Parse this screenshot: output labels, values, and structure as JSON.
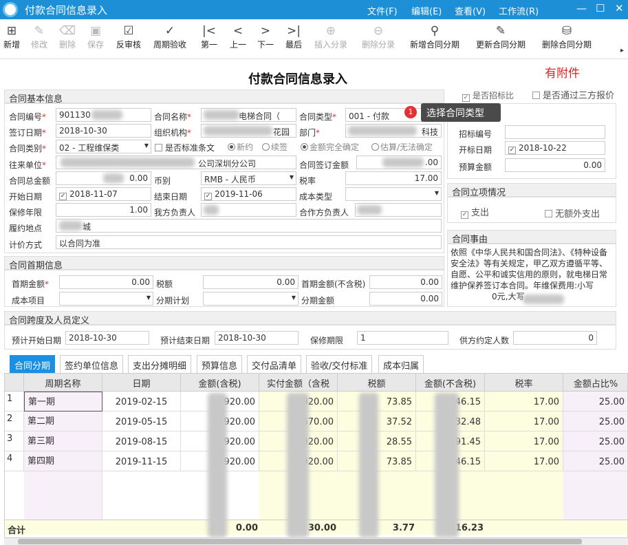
{
  "window": {
    "title": "付款合同信息录入",
    "menu": [
      "文件(F)",
      "编辑(E)",
      "查看(V)",
      "工作流(R)"
    ],
    "win": [
      "—",
      "☐",
      "✕"
    ]
  },
  "toolbar": [
    "新增",
    "修改",
    "删除",
    "保存",
    "反审核",
    "周期验收",
    "第一",
    "上一",
    "下一",
    "最后",
    "插入分录",
    "删除分录",
    "新增合同分期",
    "更新合同分期",
    "删除合同分期"
  ],
  "page": {
    "heading": "付款合同信息录入",
    "attachment": "有附件"
  },
  "basic": {
    "section": "合同基本信息",
    "contract_no_label": "合同编号",
    "contract_no": "901130",
    "contract_name_label": "合同名称",
    "contract_name": "电梯合同（",
    "contract_type_label": "合同类型",
    "contract_type": "001 - 付款",
    "sign_date_label": "签订日期",
    "sign_date": "2018-10-30",
    "org_label": "组织机构",
    "org": "花园",
    "dept_label": "部门",
    "dept": "科技",
    "category_label": "合同类别",
    "category": "02 - 工程维保类",
    "std_clause": "是否标准条文",
    "radio_new": "新约",
    "radio_renew": "续签",
    "radio_fixed": "金额完全确定",
    "radio_est": "估算/无法确定",
    "partner_label": "往来单位",
    "partner": "公司深圳分公司",
    "sign_amount_label": "合同签订金额",
    "sign_amount": ".00",
    "total_label": "合同总金额",
    "total": "0.00",
    "currency_label": "币别",
    "currency": "RMB - 人民币",
    "tax_rate_label": "税率",
    "tax_rate": "17.00",
    "start_label": "开始日期",
    "start": "2018-11-07",
    "end_label": "结束日期",
    "end": "2019-11-06",
    "cost_type_label": "成本类型",
    "warranty_label": "保修年限",
    "warranty": "1.00",
    "our_owner_label": "我方负责人",
    "partner_owner_label": "合作方负责人",
    "place_label": "履约地点",
    "place": "城",
    "pricing_label": "计价方式",
    "pricing": "以合同为准"
  },
  "right": {
    "is_bid": "是否招标比",
    "third_party": "是否通过三方报价",
    "tooltip_badge": "1",
    "tooltip": "选择合同类型",
    "bid_no_label": "招标编号",
    "bid_date_label": "开标日期",
    "bid_date": "2018-10-22",
    "budget_label": "预算金额",
    "budget": "0.00",
    "project_section": "合同立项情况",
    "expense": "支出",
    "no_extra": "无额外支出",
    "reason_section": "合同事由",
    "reason": "依照《中华人民共和国合同法》、《特种设备安全法》等有关规定，甲乙双方遵循平等、自愿、公平和诚实信用的原则，就电梯日常维护保养签订本合同。年维保费用:小写",
    "reason_tail": "0元,大写"
  },
  "first": {
    "section": "合同首期信息",
    "first_amount_label": "首期金额",
    "first_amount": "0.00",
    "tax_label": "税额",
    "tax": "0.00",
    "first_notax_label": "首期金额(不含税)",
    "first_notax": "0.00",
    "cost_item_label": "成本项目",
    "plan_label": "分期计划",
    "stage_amount_label": "分期金额",
    "stage_amount": "0.00"
  },
  "span": {
    "section": "合同跨度及人员定义",
    "pstart_label": "预计开始日期",
    "pstart": "2018-10-30",
    "pend_label": "预计结束日期",
    "pend": "2018-10-30",
    "warranty_label": "保修期限",
    "warranty": "1",
    "people_label": "供方约定人数",
    "people": "0"
  },
  "tabs": [
    "合同分期",
    "签约单位信息",
    "支出分摊明细",
    "预算信息",
    "交付品清单",
    "验收/交付标准",
    "成本归属"
  ],
  "grid": {
    "headers": [
      "周期名称",
      "日期",
      "金额(含税)",
      "实付金额（含税",
      "税额",
      "金额(不含税)",
      "税率",
      "金额占比%"
    ],
    "rows": [
      [
        "1",
        "第一期",
        "2019-02-15",
        ",920.00",
        "920.00",
        "73.85",
        "46.15",
        "17.00",
        "25.00"
      ],
      [
        "2",
        "第二期",
        "2019-05-15",
        ",920.00",
        ",670.00",
        "37.52",
        "32.48",
        "17.00",
        "25.00"
      ],
      [
        "3",
        "第三期",
        "2019-08-15",
        ",920.00",
        "920.00",
        "28.55",
        "91.45",
        "17.00",
        "25.00"
      ],
      [
        "4",
        "第四期",
        "2019-11-15",
        ",920.00",
        ",920.00",
        "73.85",
        "46.15",
        "17.00",
        "25.00"
      ]
    ],
    "total_label": "合计",
    "totals": [
      "0.00",
      "30.00",
      "3.77",
      "16.23"
    ]
  }
}
